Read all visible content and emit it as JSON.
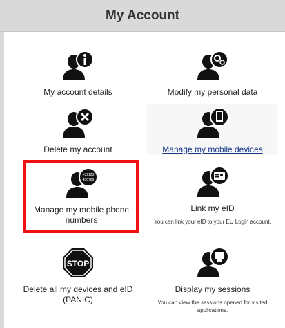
{
  "header": {
    "title": "My Account"
  },
  "tiles": [
    {
      "label": "My account details",
      "icon": "user-info-icon"
    },
    {
      "label": "Modify my personal data",
      "icon": "user-settings-icon"
    },
    {
      "label": "Delete my account",
      "icon": "user-delete-icon"
    },
    {
      "label": "Manage my mobile devices",
      "icon": "user-mobile-device-icon"
    },
    {
      "label": "Manage my mobile phone numbers",
      "icon": "user-phone-number-icon",
      "badge": "+32123 456789"
    },
    {
      "label": "Link my eID",
      "description": "You can link your eID to your EU Login account.",
      "icon": "user-eid-card-icon"
    },
    {
      "label": "Delete all my devices and eID (PANIC)",
      "icon": "stop-sign-icon",
      "badge": "STOP"
    },
    {
      "label": "Display my sessions",
      "description": "You can view the sessions opened for visited applications.",
      "icon": "user-sessions-icon"
    }
  ],
  "colors": {
    "header_bg": "#d9d9d9",
    "icon_color": "#111111",
    "highlight_border": "#ee1111",
    "link": "#1a3a8a"
  }
}
